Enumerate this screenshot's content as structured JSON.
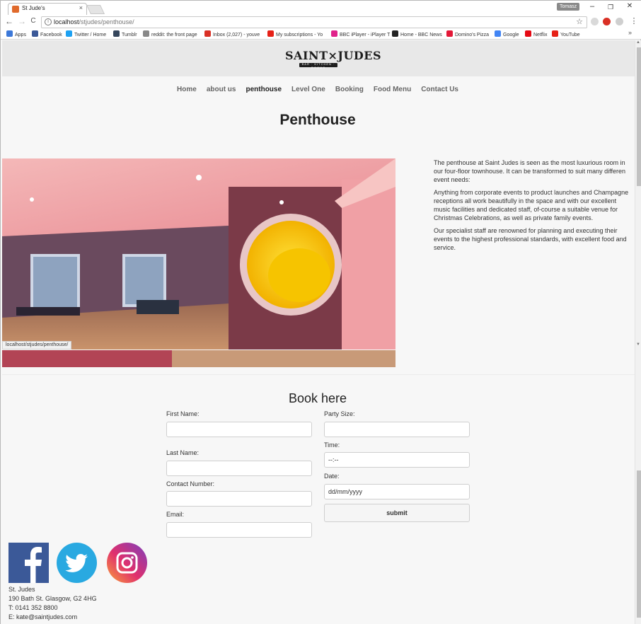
{
  "tab": {
    "title": "St Jude's",
    "close": "×"
  },
  "window": {
    "profile": "Tomasz",
    "minimize": "–",
    "restore": "❐",
    "close": "✕"
  },
  "toolbar": {
    "back": "←",
    "forward": "→",
    "reload": "C",
    "url_host": "localhost",
    "url_path": "/stjudes/penthouse/",
    "star": "☆",
    "menu": "⋮"
  },
  "bookmarks": [
    {
      "label": "Apps",
      "color": "#3c78d8"
    },
    {
      "label": "Facebook",
      "color": "#3b5998"
    },
    {
      "label": "Twitter / Home",
      "color": "#1da1f2"
    },
    {
      "label": "Tumblr",
      "color": "#35465c"
    },
    {
      "label": "reddit: the front page",
      "color": "#888888"
    },
    {
      "label": "Inbox (2,027) - youve",
      "color": "#d93025"
    },
    {
      "label": "My subscriptions - Yo",
      "color": "#e62117"
    },
    {
      "label": "BBC iPlayer - iPlayer T",
      "color": "#e0218a"
    },
    {
      "label": "Home - BBC News",
      "color": "#222222"
    },
    {
      "label": "Domino's Pizza",
      "color": "#e31837"
    },
    {
      "label": "Google",
      "color": "#4285f4"
    },
    {
      "label": "Netflix",
      "color": "#e50914"
    },
    {
      "label": "YouTube",
      "color": "#e62117"
    }
  ],
  "bookmarks_more": "»",
  "site": {
    "logo_text": "SAINT×JUDES",
    "logo_ribbon": "BAR · KITCHEN · ROOMS",
    "nav": [
      "Home",
      "about us",
      "penthouse",
      "Level One",
      "Booking",
      "Food Menu",
      "Contact Us"
    ],
    "active_nav": "penthouse",
    "page_title": "Penthouse",
    "status_url": "localhost/stjudes/penthouse/",
    "description": [
      "The penthouse at Saint Judes is seen as the most luxurious room in our four-floor townhouse. It can be transformed to suit many differen event needs:",
      "Anything from corporate events to product launches and Champagne receptions all work beautifully in the space and with our excellent music facilities and dedicated staff, of-course a suitable venue for Christmas Celebrations, as well as private family events.",
      "Our specialist staff are renowned for planning and executing their events to the highest professional standards, with excellent food and service."
    ]
  },
  "booking": {
    "title": "Book here",
    "first_name_label": "First Name:",
    "last_name_label": "Last Name:",
    "contact_label": "Contact Number:",
    "email_label": "Email:",
    "party_label": "Party Size:",
    "time_label": "Time:",
    "time_value": "--:--",
    "date_label": "Date:",
    "date_value": "dd/mm/yyyy",
    "submit_label": "submit"
  },
  "footer": {
    "social": [
      {
        "name": "facebook",
        "color": "#3b5998"
      },
      {
        "name": "twitter",
        "color": "#29a9e1"
      },
      {
        "name": "instagram",
        "color": "#c13584"
      }
    ],
    "address_lines": [
      "St. Judes",
      "190 Bath St. Glasgow, G2 4HG",
      "T: 0141 352 8800",
      "E: kate@saintjudes.com"
    ]
  }
}
